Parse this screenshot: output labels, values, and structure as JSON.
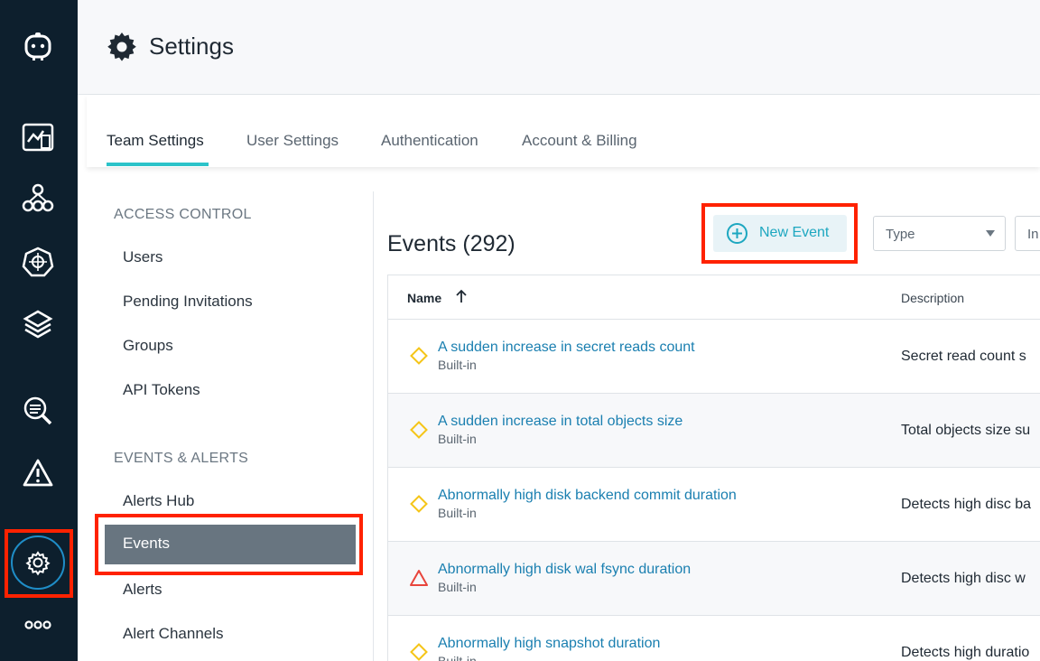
{
  "header": {
    "title": "Settings"
  },
  "tabs": [
    {
      "label": "Team Settings",
      "active": true
    },
    {
      "label": "User Settings",
      "active": false
    },
    {
      "label": "Authentication",
      "active": false
    },
    {
      "label": "Account & Billing",
      "active": false
    }
  ],
  "sidenav": {
    "access_control": {
      "label": "ACCESS CONTROL",
      "items": [
        "Users",
        "Pending Invitations",
        "Groups",
        "API Tokens"
      ]
    },
    "events_alerts": {
      "label": "EVENTS & ALERTS",
      "items": [
        "Alerts Hub",
        "Events",
        "Alerts",
        "Alert Channels"
      ],
      "active": "Events"
    }
  },
  "main": {
    "title": "Events (292)",
    "new_event_label": "New Event",
    "filters": {
      "type_label": "Type",
      "second_label": "In"
    },
    "table": {
      "columns": {
        "name": "Name",
        "description": "Description"
      },
      "rows": [
        {
          "name": "A sudden increase in secret reads count",
          "sub": "Built-in",
          "desc": "Secret read count s",
          "severity": "warning"
        },
        {
          "name": "A sudden increase in total objects size",
          "sub": "Built-in",
          "desc": "Total objects size su",
          "severity": "warning"
        },
        {
          "name": "Abnormally high disk backend commit duration",
          "sub": "Built-in",
          "desc": "Detects high disc ba",
          "severity": "warning"
        },
        {
          "name": "Abnormally high disk wal fsync duration",
          "sub": "Built-in",
          "desc": "Detects high disc w",
          "severity": "critical"
        },
        {
          "name": "Abnormally high snapshot duration",
          "sub": "Built-in",
          "desc": "Detects high duratio",
          "severity": "warning"
        }
      ]
    }
  },
  "colors": {
    "rail_bg": "#0d1f2d",
    "accent": "#2cc3c9",
    "link": "#1a7fb0",
    "warning": "#f5c518",
    "critical": "#e8453c",
    "highlight": "#ff2200"
  }
}
